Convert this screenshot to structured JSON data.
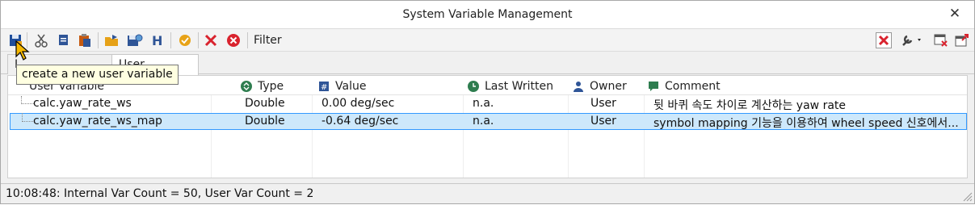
{
  "window": {
    "title": "System Variable Management",
    "close_glyph": "✕"
  },
  "toolbar": {
    "icons": [
      "new-variable-icon",
      "cut-icon",
      "copy-icon",
      "paste-icon",
      "export-icon",
      "save-config-icon",
      "header-icon",
      "certificate-icon",
      "delete-icon",
      "delete-all-icon"
    ],
    "filter_label": "Filter",
    "right_icons": [
      "clear-filter-icon",
      "settings-wrench-icon",
      "window-close-icon",
      "window-export-icon"
    ]
  },
  "tabs": [
    {
      "label": "Internal Variables",
      "visible_label": "I"
    },
    {
      "label": "User Variables"
    }
  ],
  "tooltip": {
    "text": "create a new user variable"
  },
  "table": {
    "columns": [
      {
        "label": "User Variable"
      },
      {
        "label": "Type",
        "icon": "type-icon"
      },
      {
        "label": "Value",
        "icon": "value-hash-icon"
      },
      {
        "label": "Last Written",
        "icon": "clock-icon"
      },
      {
        "label": "Owner",
        "icon": "owner-icon"
      },
      {
        "label": "Comment",
        "icon": "comment-icon"
      }
    ],
    "rows": [
      {
        "name": "calc.yaw_rate_ws",
        "type": "Double",
        "value": "0.00 deg/sec",
        "last_written": "n.a.",
        "owner": "User",
        "comment": "뒷 바퀴 속도 차이로 계산하는 yaw rate"
      },
      {
        "name": "calc.yaw_rate_ws_map",
        "type": "Double",
        "value": "-0.64 deg/sec",
        "last_written": "n.a.",
        "owner": "User",
        "comment": "symbol mapping 기능을 이용하여 wheel speed 신호에서..."
      }
    ]
  },
  "status": {
    "text": "10:08:48: Internal Var Count = 50, User Var Count = 2"
  },
  "colors": {
    "selection_bg": "#cde8fb",
    "selection_border": "#3399ff",
    "tooltip_bg": "#ffffe1",
    "delete_red": "#d9232e"
  }
}
